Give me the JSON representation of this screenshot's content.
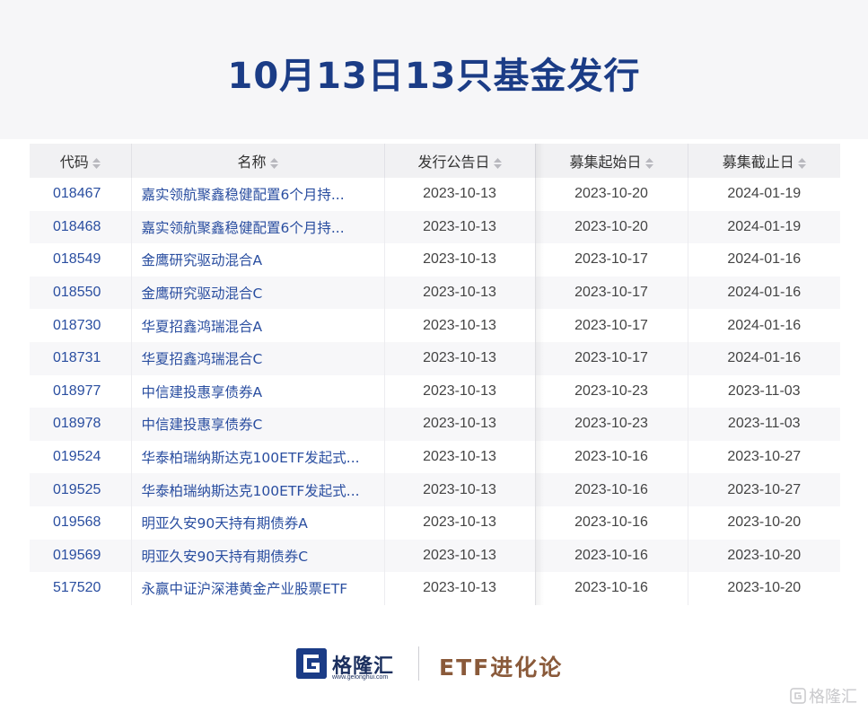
{
  "title": "10月13日13只基金发行",
  "table": {
    "headers": [
      "代码",
      "名称",
      "发行公告日",
      "募集起始日",
      "募集截止日"
    ],
    "rows": [
      {
        "code": "018467",
        "name": "嘉实领航聚鑫稳健配置6个月持...",
        "announce": "2023-10-13",
        "start": "2023-10-20",
        "end": "2024-01-19"
      },
      {
        "code": "018468",
        "name": "嘉实领航聚鑫稳健配置6个月持...",
        "announce": "2023-10-13",
        "start": "2023-10-20",
        "end": "2024-01-19"
      },
      {
        "code": "018549",
        "name": "金鹰研究驱动混合A",
        "announce": "2023-10-13",
        "start": "2023-10-17",
        "end": "2024-01-16"
      },
      {
        "code": "018550",
        "name": "金鹰研究驱动混合C",
        "announce": "2023-10-13",
        "start": "2023-10-17",
        "end": "2024-01-16"
      },
      {
        "code": "018730",
        "name": "华夏招鑫鸿瑞混合A",
        "announce": "2023-10-13",
        "start": "2023-10-17",
        "end": "2024-01-16"
      },
      {
        "code": "018731",
        "name": "华夏招鑫鸿瑞混合C",
        "announce": "2023-10-13",
        "start": "2023-10-17",
        "end": "2024-01-16"
      },
      {
        "code": "018977",
        "name": "中信建投惠享债券A",
        "announce": "2023-10-13",
        "start": "2023-10-23",
        "end": "2023-11-03"
      },
      {
        "code": "018978",
        "name": "中信建投惠享债券C",
        "announce": "2023-10-13",
        "start": "2023-10-23",
        "end": "2023-11-03"
      },
      {
        "code": "019524",
        "name": "华泰柏瑞纳斯达克100ETF发起式...",
        "announce": "2023-10-13",
        "start": "2023-10-16",
        "end": "2023-10-27"
      },
      {
        "code": "019525",
        "name": "华泰柏瑞纳斯达克100ETF发起式...",
        "announce": "2023-10-13",
        "start": "2023-10-16",
        "end": "2023-10-27"
      },
      {
        "code": "019568",
        "name": "明亚久安90天持有期债券A",
        "announce": "2023-10-13",
        "start": "2023-10-16",
        "end": "2023-10-20"
      },
      {
        "code": "019569",
        "name": "明亚久安90天持有期债券C",
        "announce": "2023-10-13",
        "start": "2023-10-16",
        "end": "2023-10-20"
      },
      {
        "code": "517520",
        "name": "永赢中证沪深港黄金产业股票ETF",
        "announce": "2023-10-13",
        "start": "2023-10-16",
        "end": "2023-10-20"
      }
    ]
  },
  "footer": {
    "logo_gelonghui": "格隆汇",
    "logo_url": "www.gelonghui.com",
    "logo_etf": "ETF进化论"
  },
  "watermark": "格隆汇",
  "colors": {
    "title": "#1b3c86",
    "link": "#2a4ea0",
    "etf_brand": "#8a5a3a"
  },
  "icons": {
    "sort": "sort-arrows-icon",
    "logo": "gelonghui-logo-icon"
  }
}
